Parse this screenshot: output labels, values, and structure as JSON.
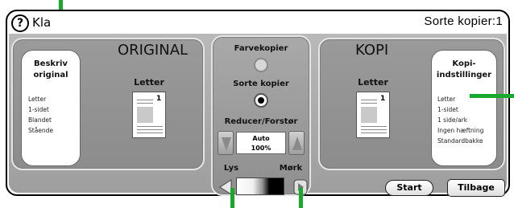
{
  "header": {
    "help_icon": "?",
    "title": "Kla",
    "copies_status": "Sorte kopier:1"
  },
  "original": {
    "title": "ORIGINAL",
    "describe_label_1": "Beskriv",
    "describe_label_2": "original",
    "settings": [
      "Letter",
      "1-sidet",
      "Blandet",
      "Stående"
    ],
    "paper_label": "Letter"
  },
  "center": {
    "color_copies_label": "Farvekopier",
    "color_copies_selected": false,
    "black_copies_label": "Sorte kopier",
    "black_copies_selected": true,
    "zoom_label": "Reducer/Forstør",
    "zoom_mode": "Auto",
    "zoom_value": "100%",
    "light_label": "Lys",
    "dark_label": "Mørk"
  },
  "copy": {
    "title": "KOPI",
    "paper_label": "Letter",
    "settings_label_1": "Kopi-",
    "settings_label_2": "indstillinger",
    "settings": [
      "Letter",
      "1-sidet",
      "1 side/ark",
      "Ingen hæftning",
      "Standardbakke"
    ]
  },
  "footer": {
    "start_label": "Start",
    "back_label": "Tilbage"
  },
  "colors": {
    "callout": "#18a82c",
    "panel": "#9a9a9a"
  }
}
